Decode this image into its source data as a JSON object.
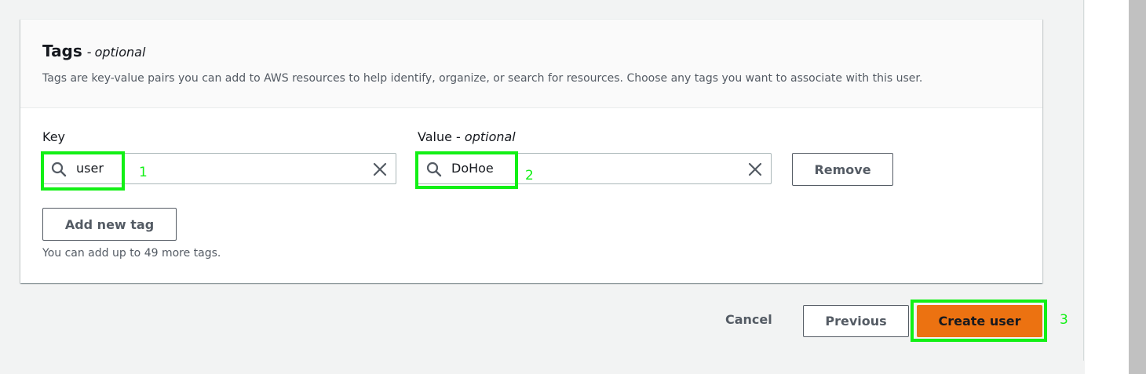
{
  "tags_section": {
    "title": "Tags",
    "separator": "-",
    "optional": "optional",
    "description": "Tags are key-value pairs you can add to AWS resources to help identify, organize, or search for resources. Choose any tags you want to associate with this user."
  },
  "tag_row": {
    "key_label": "Key",
    "key_value": "user",
    "value_label": "Value",
    "value_separator": "-",
    "value_optional": "optional",
    "value_value": "DoHoe",
    "remove_label": "Remove"
  },
  "add_tag": {
    "label": "Add new tag",
    "hint": "You can add up to 49 more tags."
  },
  "footer": {
    "cancel_label": "Cancel",
    "previous_label": "Previous",
    "create_label": "Create user"
  },
  "annotations": {
    "marker_1": "1",
    "marker_2": "2",
    "marker_3": "3"
  },
  "colors": {
    "primary_button": "#ec7211",
    "annotation_highlight": "#12f015",
    "page_background": "#f2f3f3"
  },
  "icons": [
    "search-icon",
    "clear-icon"
  ]
}
